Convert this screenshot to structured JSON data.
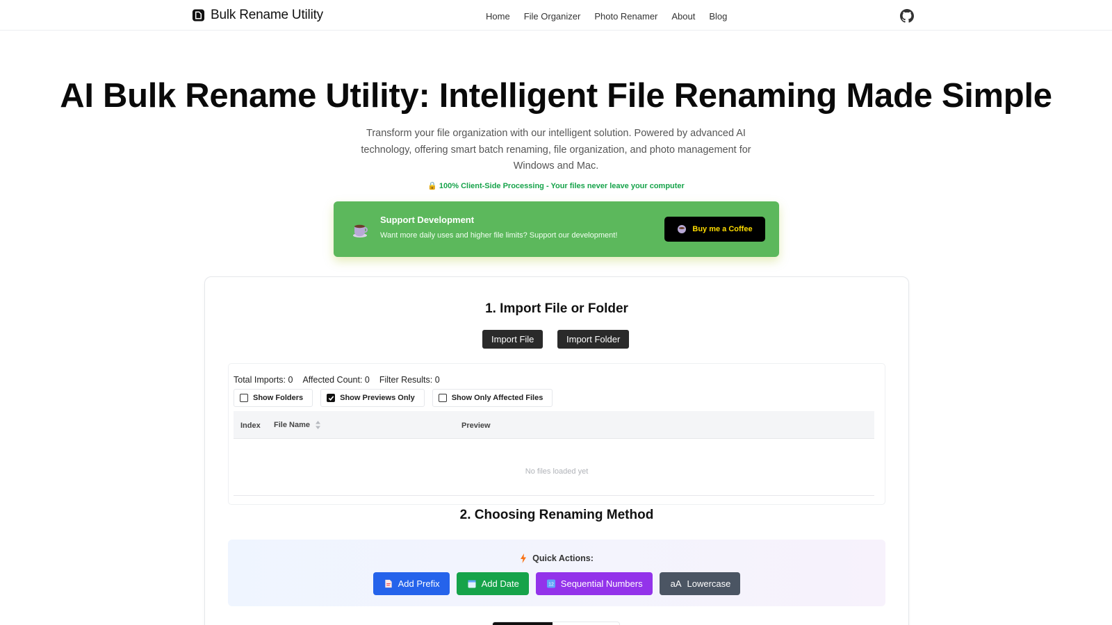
{
  "nav": {
    "brand": "Bulk Rename Utility",
    "links": [
      "Home",
      "File Organizer",
      "Photo Renamer",
      "About",
      "Blog"
    ]
  },
  "hero": {
    "title": "AI Bulk Rename Utility: Intelligent File Renaming Made Simple",
    "subtitle": "Transform your file organization with our intelligent solution. Powered by advanced AI technology, offering smart batch renaming, file organization, and photo management for Windows and Mac.",
    "privacy": "🔒 100% Client-Side Processing - Your files never leave your computer"
  },
  "support": {
    "title": "Support Development",
    "description": "Want more daily uses and higher file limits? Support our development!",
    "button": "Buy me a Coffee"
  },
  "import": {
    "title": "1. Import File or Folder",
    "import_file": "Import File",
    "import_folder": "Import Folder",
    "counts": {
      "total": "Total Imports: 0",
      "affected": "Affected Count: 0",
      "filter": "Filter Results: 0"
    },
    "filters": [
      {
        "label": "Show Folders",
        "checked": false
      },
      {
        "label": "Show Previews Only",
        "checked": true
      },
      {
        "label": "Show Only Affected Files",
        "checked": false
      }
    ],
    "columns": {
      "index": "Index",
      "file_name": "File Name",
      "preview": "Preview"
    },
    "empty": "No files loaded yet"
  },
  "method": {
    "title": "2. Choosing Renaming Method",
    "quick_title": "Quick Actions:",
    "actions": [
      {
        "label": "Add Prefix",
        "color": "#2563eb",
        "icon": "document-icon"
      },
      {
        "label": "Add Date",
        "color": "#16a34a",
        "icon": "calendar-icon"
      },
      {
        "label": "Sequential Numbers",
        "color": "#9333ea",
        "icon": "numbers-icon"
      },
      {
        "label": "Lowercase",
        "color": "#4b5563",
        "icon": "aA"
      }
    ]
  },
  "colors": {
    "support_bg": "#5cb85c",
    "privacy_text": "#16a34a",
    "coffee_text": "#ffdd00"
  }
}
